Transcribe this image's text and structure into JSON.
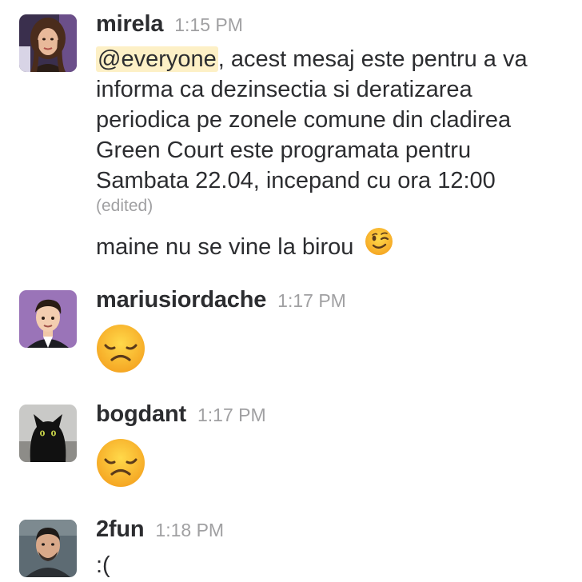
{
  "messages": [
    {
      "author": "mirela",
      "time": "1:15 PM",
      "mention": "@everyone",
      "lines": [
        ", acest mesaj este pentru a va",
        "informa ca dezinsectia si deratizarea",
        "periodica pe zonele comune din cladirea",
        "Green Court  este programata pentru",
        "Sambata 22.04, incepand cu ora 12:00"
      ],
      "edited": "(edited)",
      "followup": "maine nu se vine la birou",
      "followup_emoji": "winking-face"
    },
    {
      "author": "mariusiordache",
      "time": "1:17 PM",
      "emoji": "disappointed-face"
    },
    {
      "author": "bogdant",
      "time": "1:17 PM",
      "emoji": "disappointed-face"
    },
    {
      "author": "2fun",
      "time": "1:18 PM",
      "text": ":("
    }
  ]
}
